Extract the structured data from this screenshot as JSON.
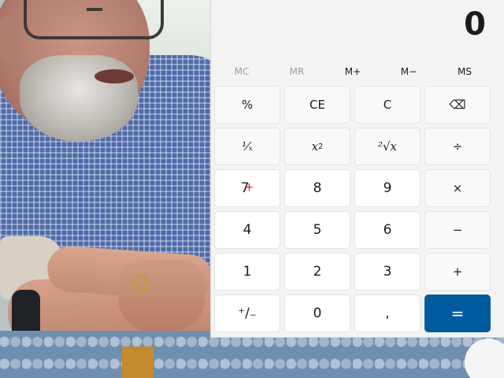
{
  "calculator": {
    "display": "0",
    "memory": [
      "MC",
      "MR",
      "M+",
      "M−",
      "MS"
    ],
    "keys": {
      "percent": "%",
      "ce": "CE",
      "c": "C",
      "backspace": "⌫",
      "reciprocal": "¹⁄ₓ",
      "square_base": "x",
      "square_exp": "2",
      "sqrt": "²√x",
      "divide": "÷",
      "seven": "7",
      "eight": "8",
      "nine": "9",
      "multiply": "×",
      "four": "4",
      "five": "5",
      "six": "6",
      "minus": "−",
      "one": "1",
      "two": "2",
      "three": "3",
      "plus": "+",
      "negate": "⁺∕₋",
      "zero": "0",
      "decimal": ",",
      "equals": "="
    }
  },
  "colors": {
    "accent": "#005a9e",
    "panel": "#f3f3f3",
    "key": "#f9f9f9",
    "number_key": "#ffffff"
  }
}
